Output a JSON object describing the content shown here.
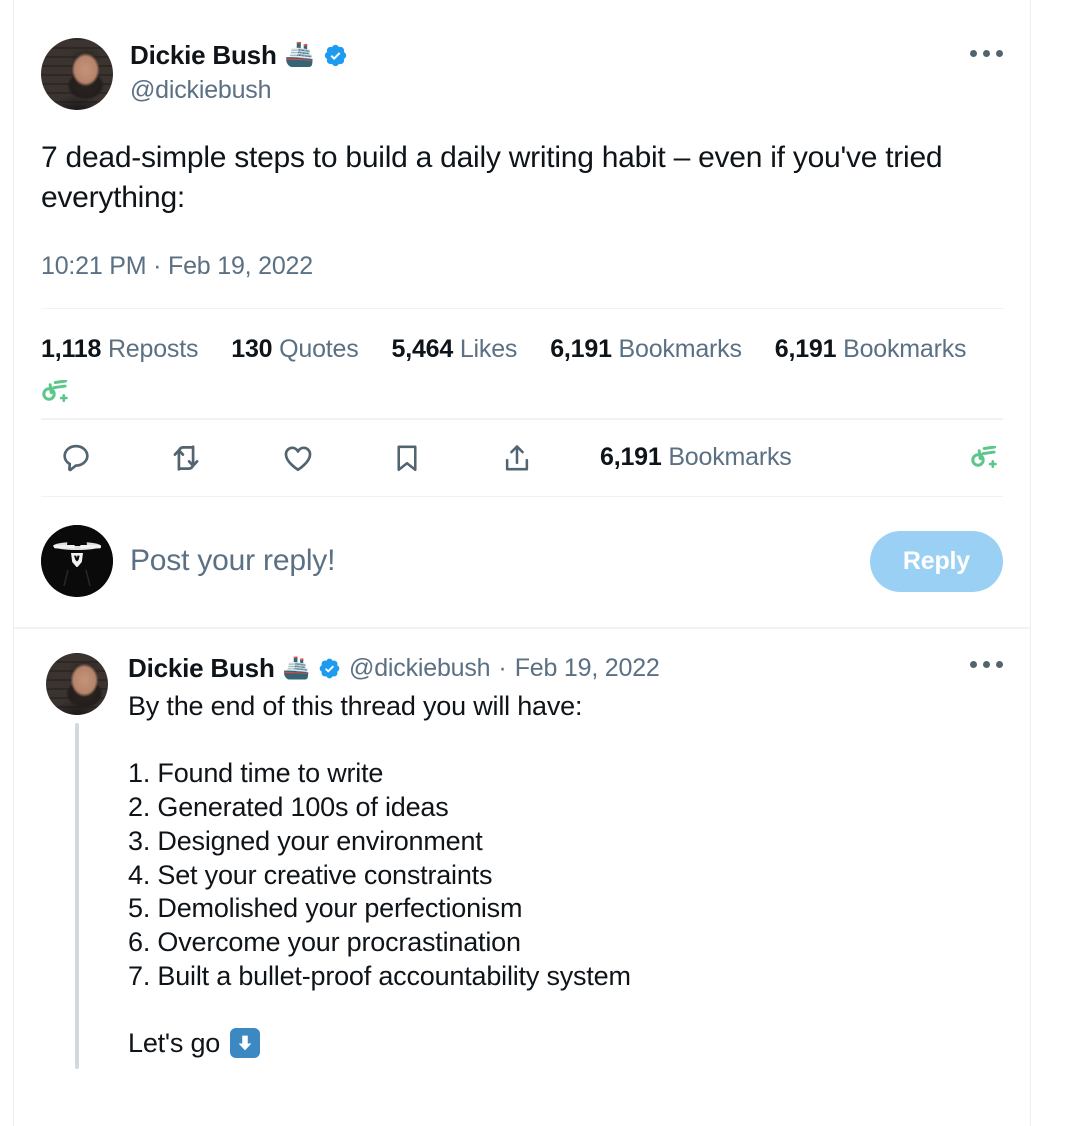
{
  "colors": {
    "accent_blue": "#1d9bf0",
    "reply_button_bg": "#9bd0f5",
    "muted_text": "#5b7083",
    "primary_text": "#0f1419",
    "divider": "#eff3f4",
    "thread_line": "#cfd9de",
    "grok_green": "#5cc78a",
    "emoji_blue": "#3b88c3"
  },
  "main_post": {
    "author": {
      "display_name": "Dickie Bush",
      "name_emoji": "🚢",
      "handle": "@dickiebush",
      "verified": true,
      "verified_icon": "verified-badge-icon",
      "avatar_alt": "dickie-bush-avatar"
    },
    "more_menu_icon": "more-options-icon",
    "text": "7 dead-simple steps to build a daily writing habit – even if you've tried everything:",
    "timestamp": "10:21 PM · Feb 19, 2022",
    "stats": [
      {
        "value": "1,118",
        "label": "Reposts"
      },
      {
        "value": "130",
        "label": "Quotes"
      },
      {
        "value": "5,464",
        "label": "Likes"
      },
      {
        "value": "6,191",
        "label": "Bookmarks"
      },
      {
        "value": "6,191",
        "label": "Bookmarks"
      }
    ],
    "grok_icon": "grok-analytics-icon",
    "action_bar": {
      "reply_icon": "reply-comment-icon",
      "repost_icon": "repost-retweet-icon",
      "like_icon": "like-heart-icon",
      "bookmark_icon": "bookmark-icon",
      "share_icon": "share-upload-icon",
      "bar_stat_value": "6,191",
      "bar_stat_label": "Bookmarks",
      "grok_icon": "grok-analytics-icon"
    }
  },
  "composer": {
    "avatar_alt": "user-avatar-anonymous-mask",
    "placeholder": "Post your reply!",
    "reply_button_label": "Reply"
  },
  "reply_post": {
    "author": {
      "display_name": "Dickie Bush",
      "name_emoji": "🚢",
      "handle": "@dickiebush",
      "separator": "·",
      "date": "Feb 19, 2022",
      "verified": true,
      "verified_icon": "verified-badge-icon",
      "avatar_alt": "dickie-bush-avatar"
    },
    "more_menu_icon": "more-options-icon",
    "intro": "By the end of this thread you will have:",
    "list": [
      "1. Found time to write",
      "2. Generated 100s of ideas",
      "3. Designed your environment",
      "4. Set your creative constraints",
      "5. Demolished your perfectionism",
      "6. Overcome your procrastination",
      "7. Built a bullet-proof accountability system"
    ],
    "outro_text": "Let's go",
    "outro_emoji": "⬇️",
    "outro_emoji_name": "down-arrow-emoji"
  }
}
